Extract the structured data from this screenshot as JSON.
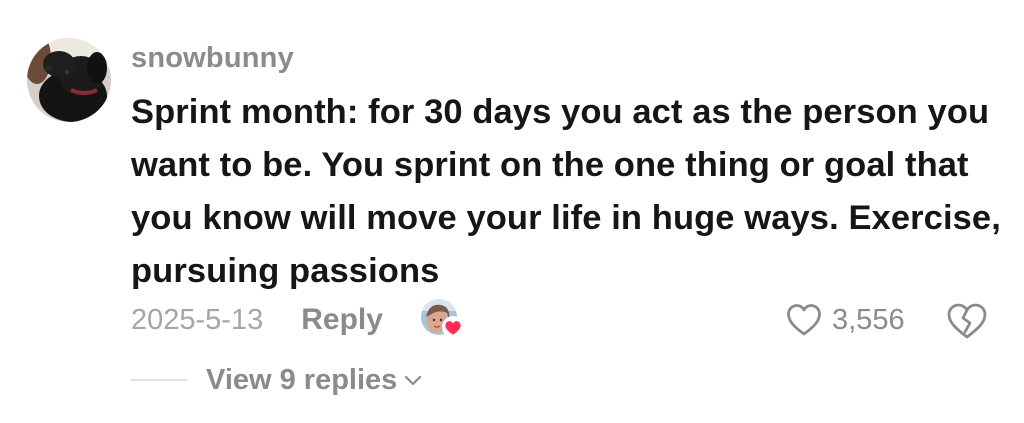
{
  "comment": {
    "username": "snowbunny",
    "text": "Sprint month: for 30 days you act as the person you want to be. You sprint on the one thing or goal that you know will move your life in huge ways. Exercise, pursuing passions",
    "date": "2025-5-13",
    "reply_label": "Reply",
    "like_count": "3,556",
    "view_replies_label": "View 9 replies"
  },
  "icons": {
    "like": "heart-outline-icon",
    "dislike": "broken-heart-icon",
    "expand": "chevron-down-icon",
    "creator_liked_badge": "heart-icon"
  },
  "colors": {
    "primary_text": "#161616",
    "secondary_text": "#8a8a8f",
    "muted_text": "#a5a5aa",
    "heart_badge": "#fe2c55"
  }
}
